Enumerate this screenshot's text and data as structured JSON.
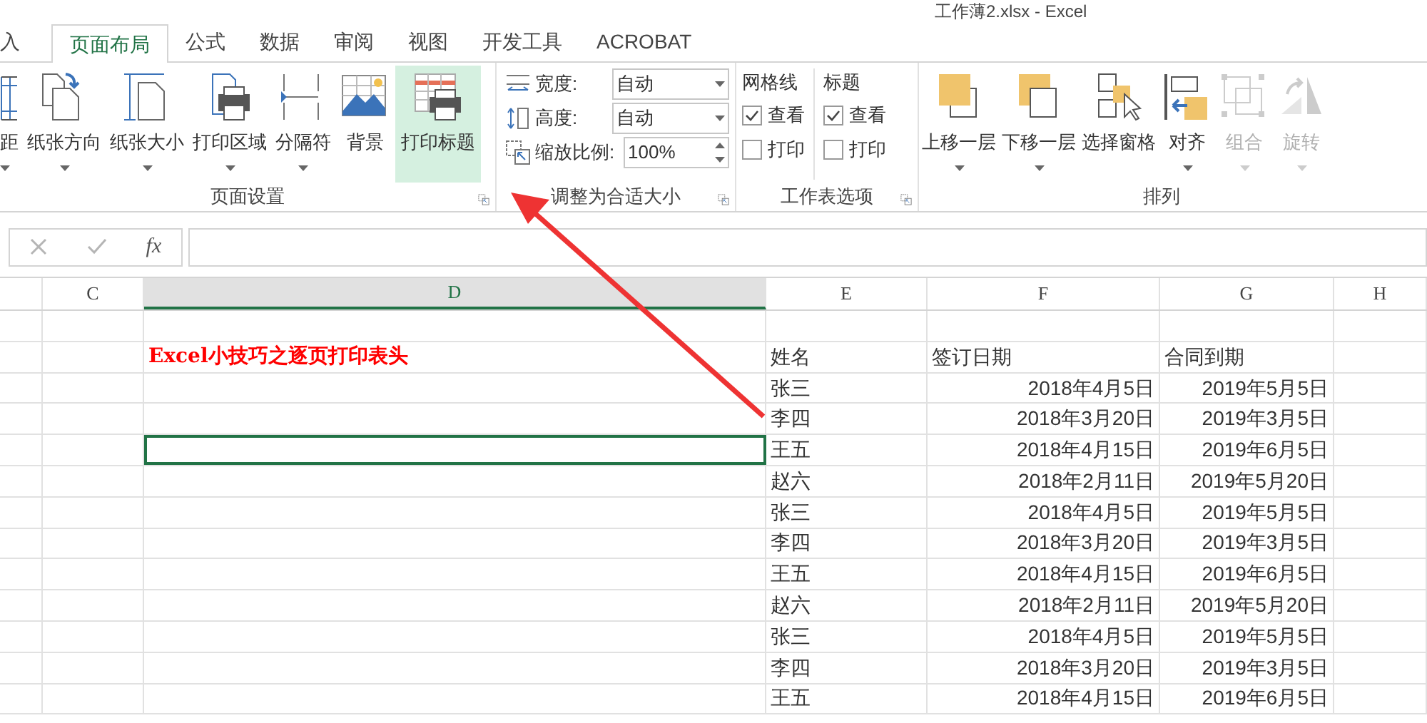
{
  "window": {
    "title": "工作薄2.xlsx - Excel"
  },
  "tabs": [
    {
      "label": "入",
      "selected": false
    },
    {
      "label": "页面布局",
      "selected": true
    },
    {
      "label": "公式",
      "selected": false
    },
    {
      "label": "数据",
      "selected": false
    },
    {
      "label": "审阅",
      "selected": false
    },
    {
      "label": "视图",
      "selected": false
    },
    {
      "label": "开发工具",
      "selected": false
    },
    {
      "label": "ACROBAT",
      "selected": false
    }
  ],
  "page_setup": {
    "label": "页面设置",
    "buttons": [
      {
        "label": "距",
        "dropdown": true,
        "highlighted": false
      },
      {
        "label": "纸张方向",
        "dropdown": true,
        "highlighted": false
      },
      {
        "label": "纸张大小",
        "dropdown": true,
        "highlighted": false
      },
      {
        "label": "打印区域",
        "dropdown": true,
        "highlighted": false
      },
      {
        "label": "分隔符",
        "dropdown": true,
        "highlighted": false
      },
      {
        "label": "背景",
        "dropdown": false,
        "highlighted": false
      },
      {
        "label": "打印标题",
        "dropdown": false,
        "highlighted": true
      }
    ]
  },
  "scale_to_fit": {
    "label": "调整为合适大小",
    "fields": [
      {
        "label": "宽度:",
        "value": "自动",
        "kind": "dropdown"
      },
      {
        "label": "高度:",
        "value": "自动",
        "kind": "dropdown"
      },
      {
        "label": "缩放比例:",
        "value": "100%",
        "kind": "spinner"
      }
    ]
  },
  "sheet_options": {
    "label": "工作表选项",
    "columns": [
      {
        "heading": "网格线",
        "options": [
          {
            "label": "查看",
            "checked": true
          },
          {
            "label": "打印",
            "checked": false
          }
        ]
      },
      {
        "heading": "标题",
        "options": [
          {
            "label": "查看",
            "checked": true
          },
          {
            "label": "打印",
            "checked": false
          }
        ]
      }
    ]
  },
  "arrange": {
    "label": "排列",
    "buttons": [
      {
        "label": "上移一层",
        "dropdown": true,
        "disabled": false
      },
      {
        "label": "下移一层",
        "dropdown": true,
        "disabled": false
      },
      {
        "label": "选择窗格",
        "dropdown": false,
        "disabled": false
      },
      {
        "label": "对齐",
        "dropdown": true,
        "disabled": false
      },
      {
        "label": "组合",
        "dropdown": true,
        "disabled": true
      },
      {
        "label": "旋转",
        "dropdown": true,
        "disabled": true
      }
    ]
  },
  "formula_bar": {
    "function_label": "fx"
  },
  "sheet": {
    "columns": [
      {
        "label": "C",
        "selected": false
      },
      {
        "label": "D",
        "selected": true
      },
      {
        "label": "E",
        "selected": false
      },
      {
        "label": "F",
        "selected": false
      },
      {
        "label": "G",
        "selected": false
      },
      {
        "label": "H",
        "selected": false
      }
    ],
    "rows": [
      {
        "kind": "blank",
        "active": false
      },
      {
        "kind": "header",
        "title": "Excel小技巧之逐页打印表头",
        "cells": [
          "姓名",
          "签订日期",
          "合同到期"
        ],
        "active": false
      },
      {
        "kind": "data",
        "cells": [
          "张三",
          "2018年4月5日",
          "2019年5月5日"
        ],
        "active": false
      },
      {
        "kind": "data",
        "cells": [
          "李四",
          "2018年3月20日",
          "2019年3月5日"
        ],
        "active": false
      },
      {
        "kind": "data",
        "cells": [
          "王五",
          "2018年4月15日",
          "2019年6月5日"
        ],
        "active": true
      },
      {
        "kind": "data",
        "cells": [
          "赵六",
          "2018年2月11日",
          "2019年5月20日"
        ],
        "active": false
      },
      {
        "kind": "data",
        "cells": [
          "张三",
          "2018年4月5日",
          "2019年5月5日"
        ],
        "active": false
      },
      {
        "kind": "data",
        "cells": [
          "李四",
          "2018年3月20日",
          "2019年3月5日"
        ],
        "active": false
      },
      {
        "kind": "data",
        "cells": [
          "王五",
          "2018年4月15日",
          "2019年6月5日"
        ],
        "active": false
      },
      {
        "kind": "data",
        "cells": [
          "赵六",
          "2018年2月11日",
          "2019年5月20日"
        ],
        "active": false
      },
      {
        "kind": "data",
        "cells": [
          "张三",
          "2018年4月5日",
          "2019年5月5日"
        ],
        "active": false
      },
      {
        "kind": "data",
        "cells": [
          "李四",
          "2018年3月20日",
          "2019年3月5日"
        ],
        "active": false
      },
      {
        "kind": "data",
        "cells": [
          "王五",
          "2018年4月15日",
          "2019年6月5日"
        ],
        "active": false
      }
    ]
  }
}
